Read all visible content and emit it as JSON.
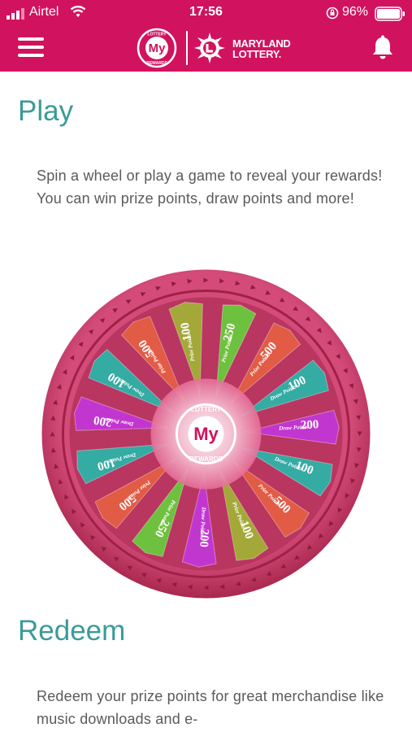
{
  "status_bar": {
    "carrier": "Airtel",
    "time": "17:56",
    "battery_percent": "96%"
  },
  "header": {
    "logo_left": {
      "top": "LOTTERY",
      "middle": "My",
      "bottom": "REWARDS"
    },
    "logo_right_lines": [
      "MARYLAND",
      "LOTTERY."
    ]
  },
  "play": {
    "title": "Play",
    "text": "Spin a wheel or play a game to reveal your rewards! You can win prize points, draw points and more!"
  },
  "wheel": {
    "center": {
      "top": "LOTTERY",
      "middle": "My",
      "bottom": "REWARDS"
    },
    "segments": [
      {
        "value": "250",
        "label": "Prize Points",
        "color": "#6ec13e"
      },
      {
        "value": "500",
        "label": "Prize Points",
        "color": "#e15b45"
      },
      {
        "value": "100",
        "label": "Draw Points",
        "color": "#34aba3"
      },
      {
        "value": "200",
        "label": "Draw Points",
        "color": "#c236d0"
      },
      {
        "value": "100",
        "label": "Draw Points",
        "color": "#34aba3"
      },
      {
        "value": "500",
        "label": "Prize Points",
        "color": "#e15b45"
      },
      {
        "value": "100",
        "label": "Prize Points",
        "color": "#a3a839"
      },
      {
        "value": "200",
        "label": "Draw Points",
        "color": "#c236d0"
      },
      {
        "value": "250",
        "label": "Prize Points",
        "color": "#6ec13e"
      },
      {
        "value": "500",
        "label": "Prize Points",
        "color": "#e15b45"
      },
      {
        "value": "100",
        "label": "Draw Points",
        "color": "#34aba3"
      },
      {
        "value": "200",
        "label": "Draw Points",
        "color": "#c236d0"
      },
      {
        "value": "100",
        "label": "Draw Points",
        "color": "#34aba3"
      },
      {
        "value": "500",
        "label": "Prize Points",
        "color": "#e15b45"
      },
      {
        "value": "100",
        "label": "Prize Points",
        "color": "#a3a839"
      }
    ]
  },
  "redeem": {
    "title": "Redeem",
    "text": "Redeem your prize points for great merchandise like music downloads and e-"
  },
  "colors": {
    "brand": "#d1125f",
    "heading": "#3a9b99",
    "wheel_rim": "#c93a6b"
  }
}
